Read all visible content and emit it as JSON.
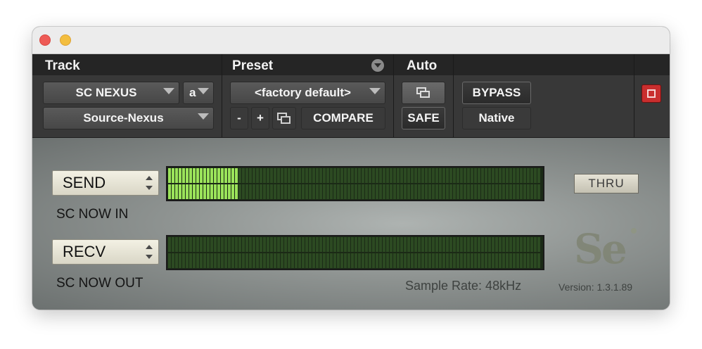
{
  "header": {
    "track": {
      "label": "Track",
      "track_name": "SC NEXUS",
      "channel": "a",
      "insert": "Source-Nexus"
    },
    "preset": {
      "label": "Preset",
      "name": "<factory default>",
      "minus": "-",
      "plus": "+",
      "compare": "COMPARE"
    },
    "auto": {
      "label": "Auto",
      "safe": "SAFE"
    },
    "bypass": "BYPASS",
    "native": "Native"
  },
  "plugin": {
    "send": {
      "select": "SEND",
      "label": "SC NOW IN",
      "level": 0.19
    },
    "recv": {
      "select": "RECV",
      "label": "SC NOW OUT",
      "level": 0.0
    },
    "thru": "THRU",
    "sample_rate": "Sample Rate: 48kHz",
    "version": "Version: 1.3.1.89",
    "logo": "Se"
  },
  "colors": {
    "meter_on": "#9be35a",
    "meter_off": "#2c4a22",
    "bypass_red": "#c92e2e"
  }
}
